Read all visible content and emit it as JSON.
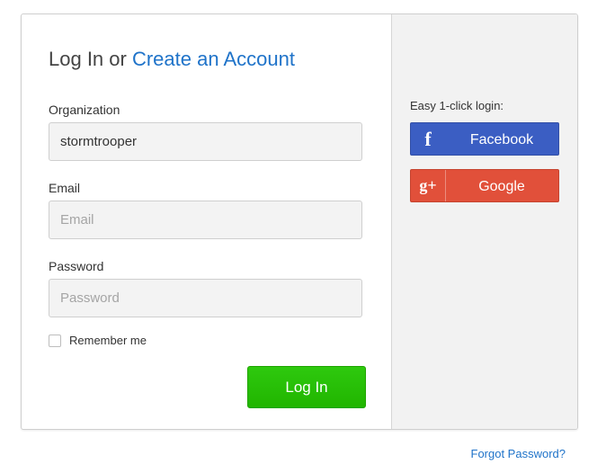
{
  "heading": {
    "prefix": "Log In or ",
    "link": "Create an Account"
  },
  "organization": {
    "label": "Organization",
    "value": "stormtrooper",
    "placeholder": ""
  },
  "email": {
    "label": "Email",
    "value": "",
    "placeholder": "Email"
  },
  "password": {
    "label": "Password",
    "value": "",
    "placeholder": "Password"
  },
  "remember": {
    "label": "Remember me",
    "checked": false
  },
  "login_button": "Log In",
  "social": {
    "title": "Easy 1-click login:",
    "facebook": {
      "label": "Facebook",
      "icon": "f",
      "color": "#3b5ec3"
    },
    "google": {
      "label": "Google",
      "icon": "g+",
      "color": "#e1503a"
    }
  },
  "forgot_password": "Forgot Password?",
  "colors": {
    "link": "#1f73c9",
    "login_green": "#21b500"
  }
}
